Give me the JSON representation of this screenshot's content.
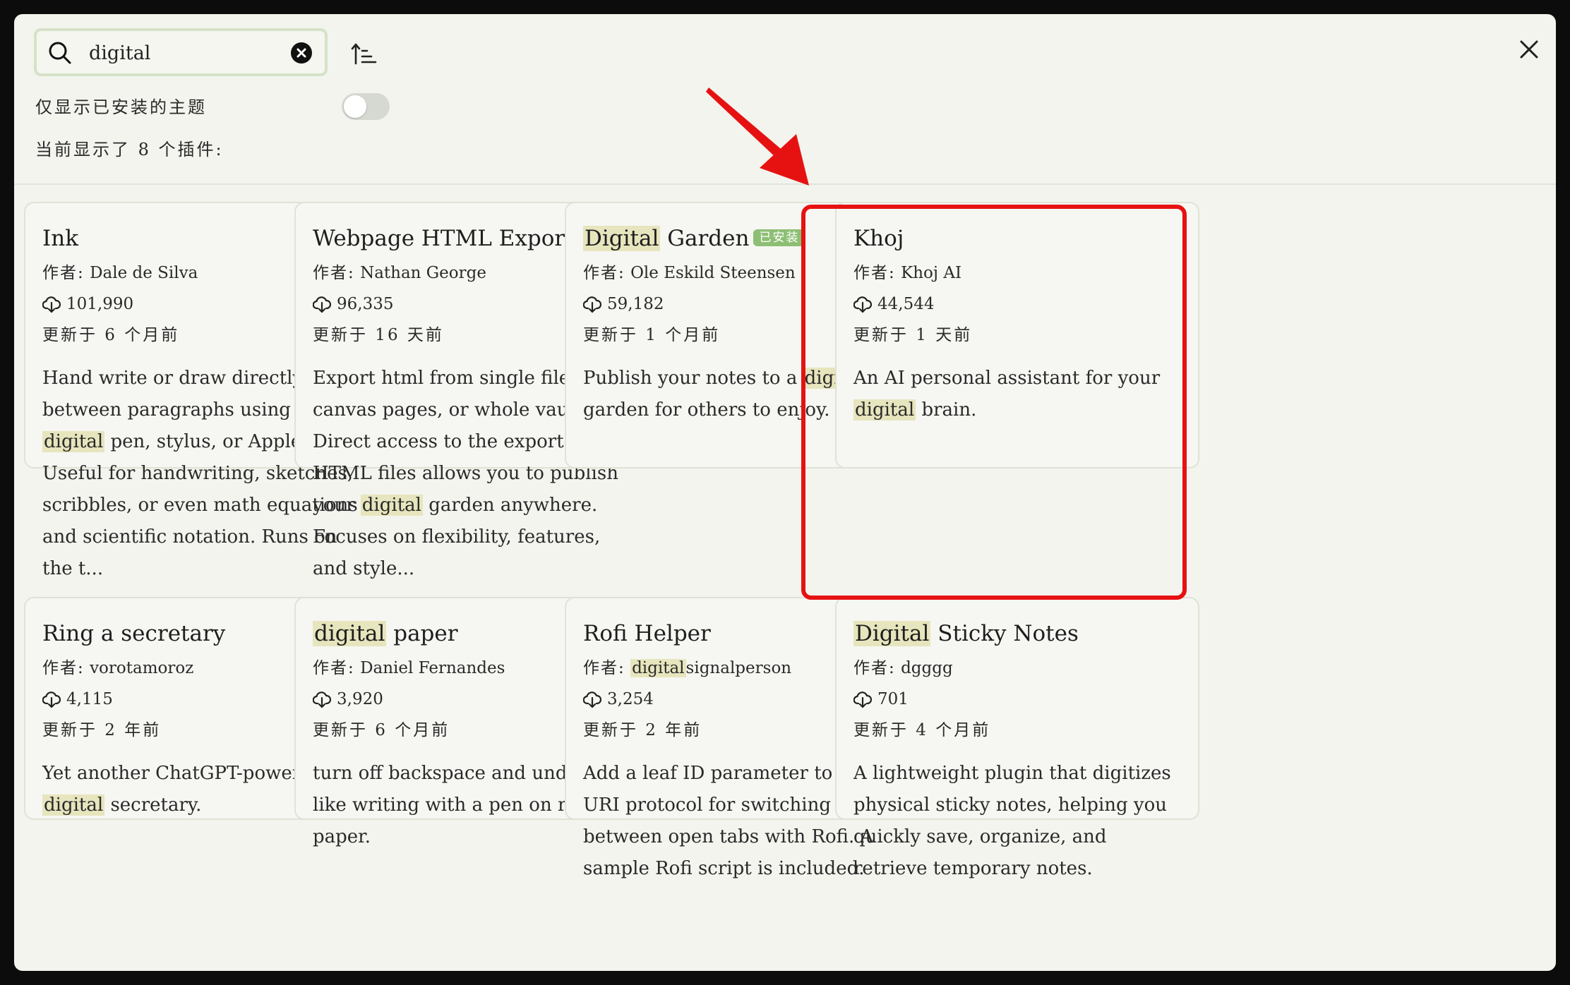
{
  "search": {
    "value": "digital",
    "placeholder": ""
  },
  "toggle_label": "仅显示已安装的主题",
  "toggle_on": false,
  "count_text": "当前显示了 8 个插件:",
  "author_prefix": "作者:",
  "installed_badge": "已安装",
  "highlight_term": "digital",
  "icons": {
    "search": "search-icon",
    "clear": "clear-icon",
    "sort": "sort-icon",
    "close": "close-icon",
    "download": "download-icon"
  },
  "colors": {
    "highlight": "#e7e5bd",
    "badge": "#8cbf73",
    "annotation": "#e61212"
  },
  "plugins": [
    {
      "title": "Ink",
      "author": "Dale de Silva",
      "downloads": "101,990",
      "updated": "更新于 6 个月前",
      "description": "Hand write or draw directly between paragraphs using a digital pen, stylus, or Apple pencil. Useful for handwriting, sketches, scribbles, or even math equations and scientific notation. Runs on the t...",
      "installed": false
    },
    {
      "title": "Webpage HTML Export",
      "author": "Nathan George",
      "downloads": "96,335",
      "updated": "更新于 16 天前",
      "description": "Export html from single files, canvas pages, or whole vaults. Direct access to the exported HTML files allows you to publish your digital garden anywhere. Focuses on flexibility, features, and style...",
      "installed": false
    },
    {
      "title": "Digital Garden",
      "author": "Ole Eskild Steensen",
      "downloads": "59,182",
      "updated": "更新于 1 个月前",
      "description": "Publish your notes to a digital garden for others to enjoy.",
      "installed": true
    },
    {
      "title": "Khoj",
      "author": "Khoj AI",
      "downloads": "44,544",
      "updated": "更新于 1 天前",
      "description": "An AI personal assistant for your digital brain.",
      "installed": false
    },
    {
      "title": "Ring a secretary",
      "author": "vorotamoroz",
      "downloads": "4,115",
      "updated": "更新于 2 年前",
      "description": "Yet another ChatGPT-powered digital secretary.",
      "installed": false
    },
    {
      "title": "digital paper",
      "author": "Daniel Fernandes",
      "downloads": "3,920",
      "updated": "更新于 6 个月前",
      "description": "turn off backspace and undo, just like writing with a pen on real paper.",
      "installed": false
    },
    {
      "title": "Rofi Helper",
      "author": "digitalsignalperson",
      "downloads": "3,254",
      "updated": "更新于 2 年前",
      "description": "Add a leaf ID parameter to the URI protocol for switching between open tabs with Rofi. A sample Rofi script is included.",
      "installed": false
    },
    {
      "title": "Digital Sticky Notes",
      "author": "dgggg",
      "downloads": "701",
      "updated": "更新于 4 个月前",
      "description": "A lightweight plugin that digitizes physical sticky notes, helping you quickly save, organize, and retrieve temporary notes.",
      "installed": false
    }
  ]
}
